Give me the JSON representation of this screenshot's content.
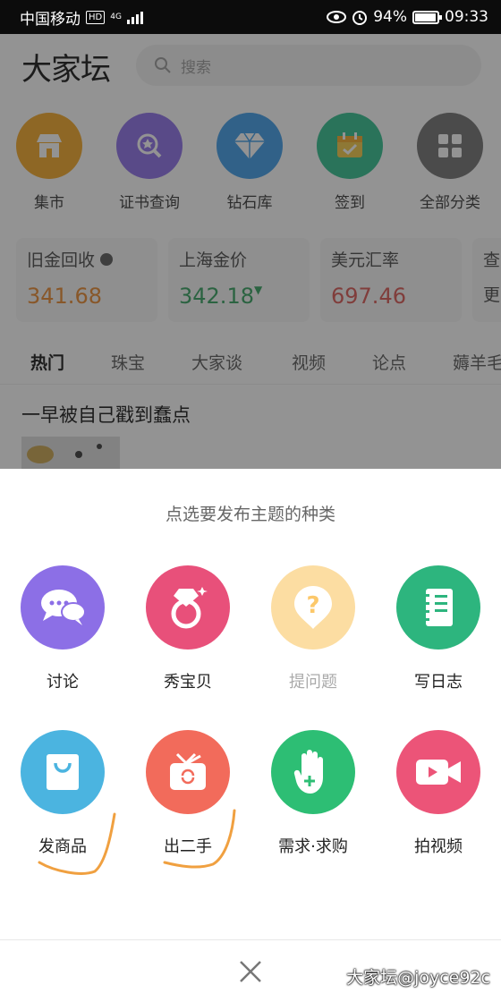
{
  "status_bar": {
    "carrier": "中国移动",
    "hd_badge": "HD",
    "network": "4G",
    "battery": "94%",
    "battery_level": 0.94,
    "time": "09:33"
  },
  "header": {
    "logo": "大家坛",
    "search_placeholder": "搜索"
  },
  "categories": [
    {
      "label": "集市",
      "icon": "shop-icon",
      "color": "#F5A623"
    },
    {
      "label": "证书查询",
      "icon": "certificate-search-icon",
      "color": "#8B6CE8"
    },
    {
      "label": "钻石库",
      "icon": "diamond-icon",
      "color": "#3B9BE8"
    },
    {
      "label": "签到",
      "icon": "calendar-check-icon",
      "color": "#2DBE8C"
    },
    {
      "label": "全部分类",
      "icon": "grid-icon",
      "color": "#6E6E6E"
    }
  ],
  "price_cards": [
    {
      "title": "旧金回收",
      "value": "341.68",
      "color": "#E8862A"
    },
    {
      "title": "上海金价",
      "value": "342.18",
      "color": "#2E9E5B"
    },
    {
      "title": "美元汇率",
      "value": "697.46",
      "color": "#D9534F"
    },
    {
      "title": "查",
      "value": "更"
    }
  ],
  "tabs": [
    "热门",
    "珠宝",
    "大家谈",
    "视频",
    "论点",
    "薅羊毛"
  ],
  "article": {
    "title": "一早被自己戳到蠢点"
  },
  "sheet": {
    "title": "点选要发布主题的种类",
    "options": [
      {
        "label": "讨论",
        "icon": "chat-bubbles-icon",
        "color": "#8C6FE6"
      },
      {
        "label": "秀宝贝",
        "icon": "diamond-ring-icon",
        "color": "#E8507A"
      },
      {
        "label": "提问题",
        "icon": "question-icon",
        "color": "#FCDDA2"
      },
      {
        "label": "写日志",
        "icon": "notebook-icon",
        "color": "#2DB57E"
      },
      {
        "label": "发商品",
        "icon": "shopping-bag-icon",
        "color": "#4BB4E0"
      },
      {
        "label": "出二手",
        "icon": "secondhand-box-icon",
        "color": "#F26B5B"
      },
      {
        "label": "需求·求购",
        "icon": "hand-plus-icon",
        "color": "#2DBE74"
      },
      {
        "label": "拍视频",
        "icon": "video-camera-icon",
        "color": "#EC5478"
      }
    ]
  },
  "watermark": "大家坛@joyce92c"
}
